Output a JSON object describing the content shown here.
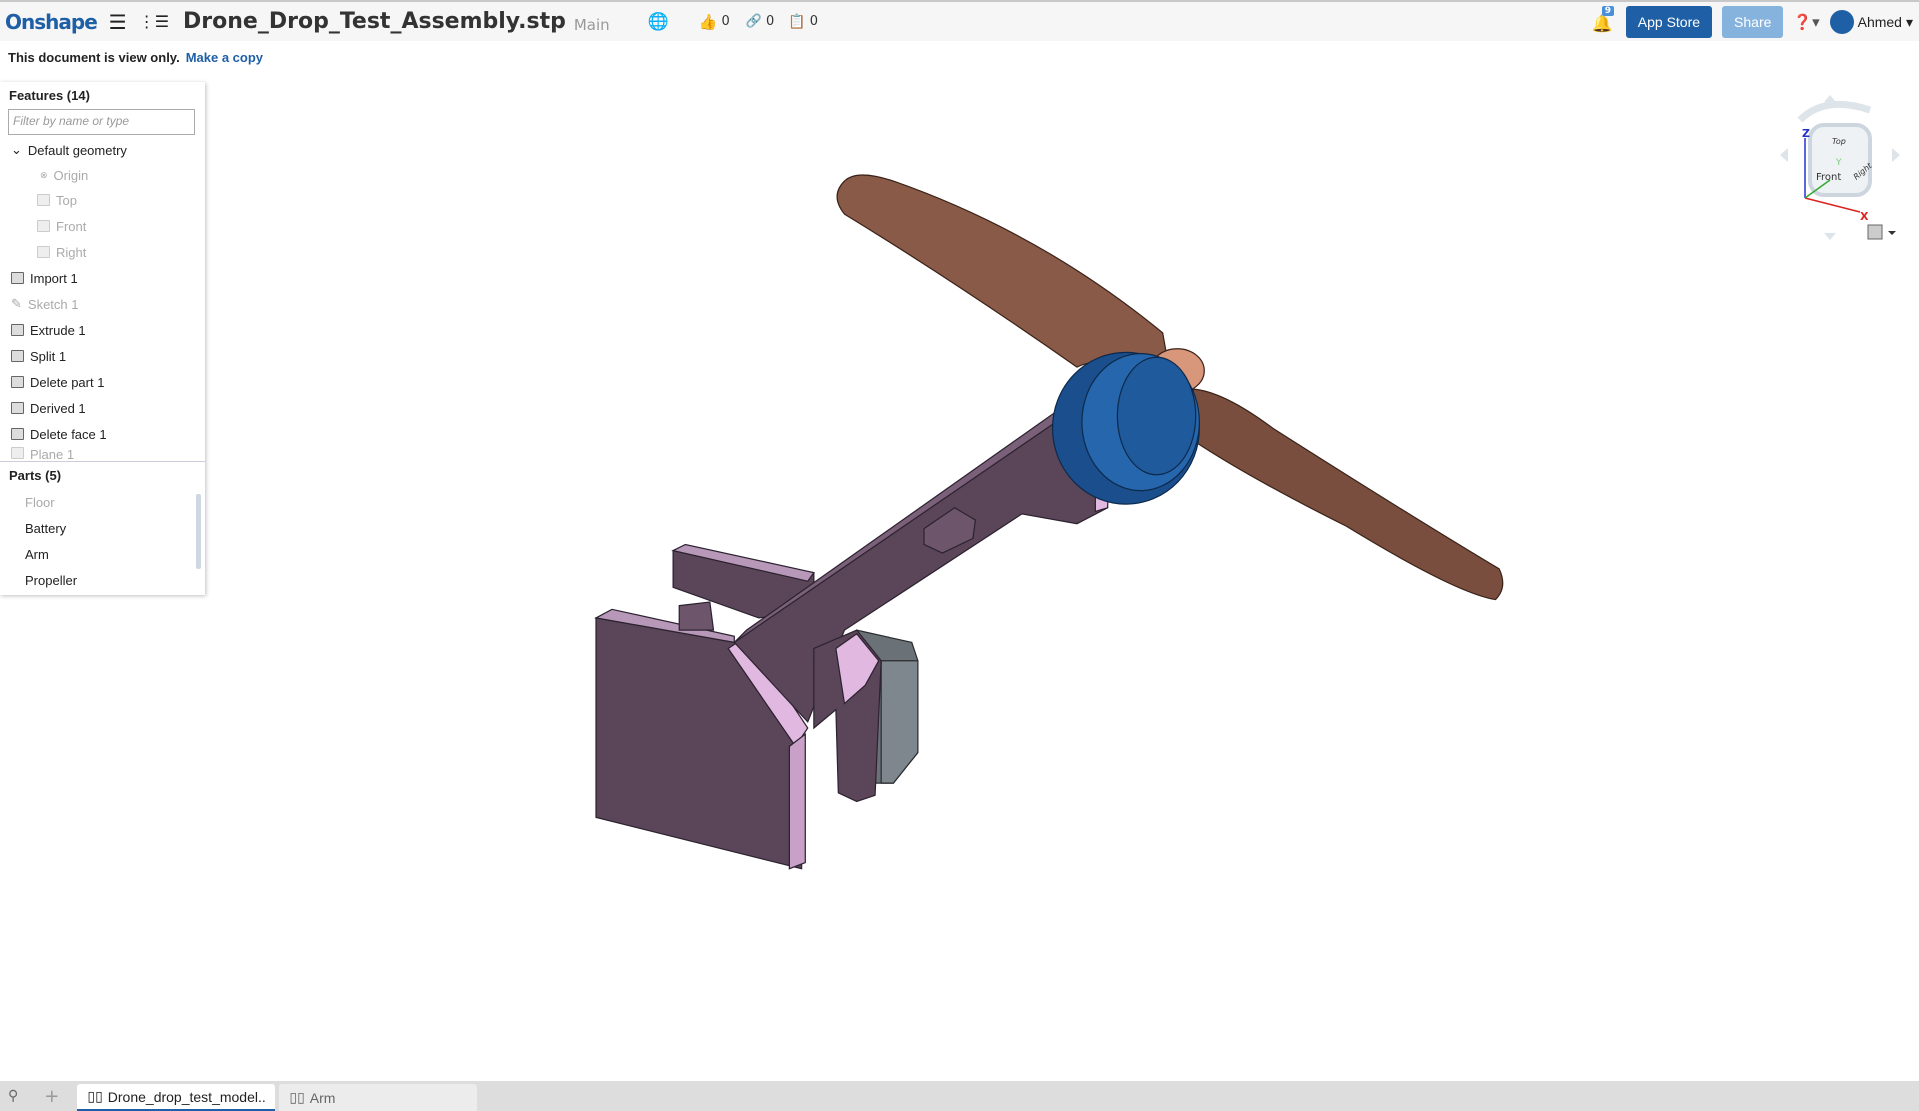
{
  "header": {
    "logo": "Onshape",
    "document_title": "Drone_Drop_Test_Assembly.stp",
    "branch": "Main",
    "likes": "0",
    "links": "0",
    "copies": "0",
    "notifications": "9",
    "app_store": "App Store",
    "share": "Share",
    "user": "Ahmed"
  },
  "banner": {
    "text": "This document is view only.",
    "link": "Make a copy"
  },
  "features": {
    "title": "Features (14)",
    "filter_placeholder": "Filter by name or type",
    "group": "Default geometry",
    "defaults": [
      "Origin",
      "Top",
      "Front",
      "Right"
    ],
    "items": [
      "Import 1",
      "Sketch 1",
      "Extrude 1",
      "Split 1",
      "Delete part 1",
      "Derived 1",
      "Delete face 1",
      "Plane 1"
    ]
  },
  "parts": {
    "title": "Parts (5)",
    "items": [
      "Floor",
      "Battery",
      "Arm",
      "Propeller"
    ]
  },
  "view_cube": {
    "top": "Top",
    "front": "Front",
    "right": "Right",
    "x": "X",
    "y": "Y",
    "z": "Z"
  },
  "tabs": [
    {
      "label": "Drone_drop_test_model.."
    },
    {
      "label": "Arm"
    }
  ],
  "colors": {
    "brand": "#1f5fa6",
    "propeller": "#8a5a48",
    "motor": "#1e5a9c",
    "arm": "#5a4658",
    "highlight": "#e0b8e0"
  }
}
